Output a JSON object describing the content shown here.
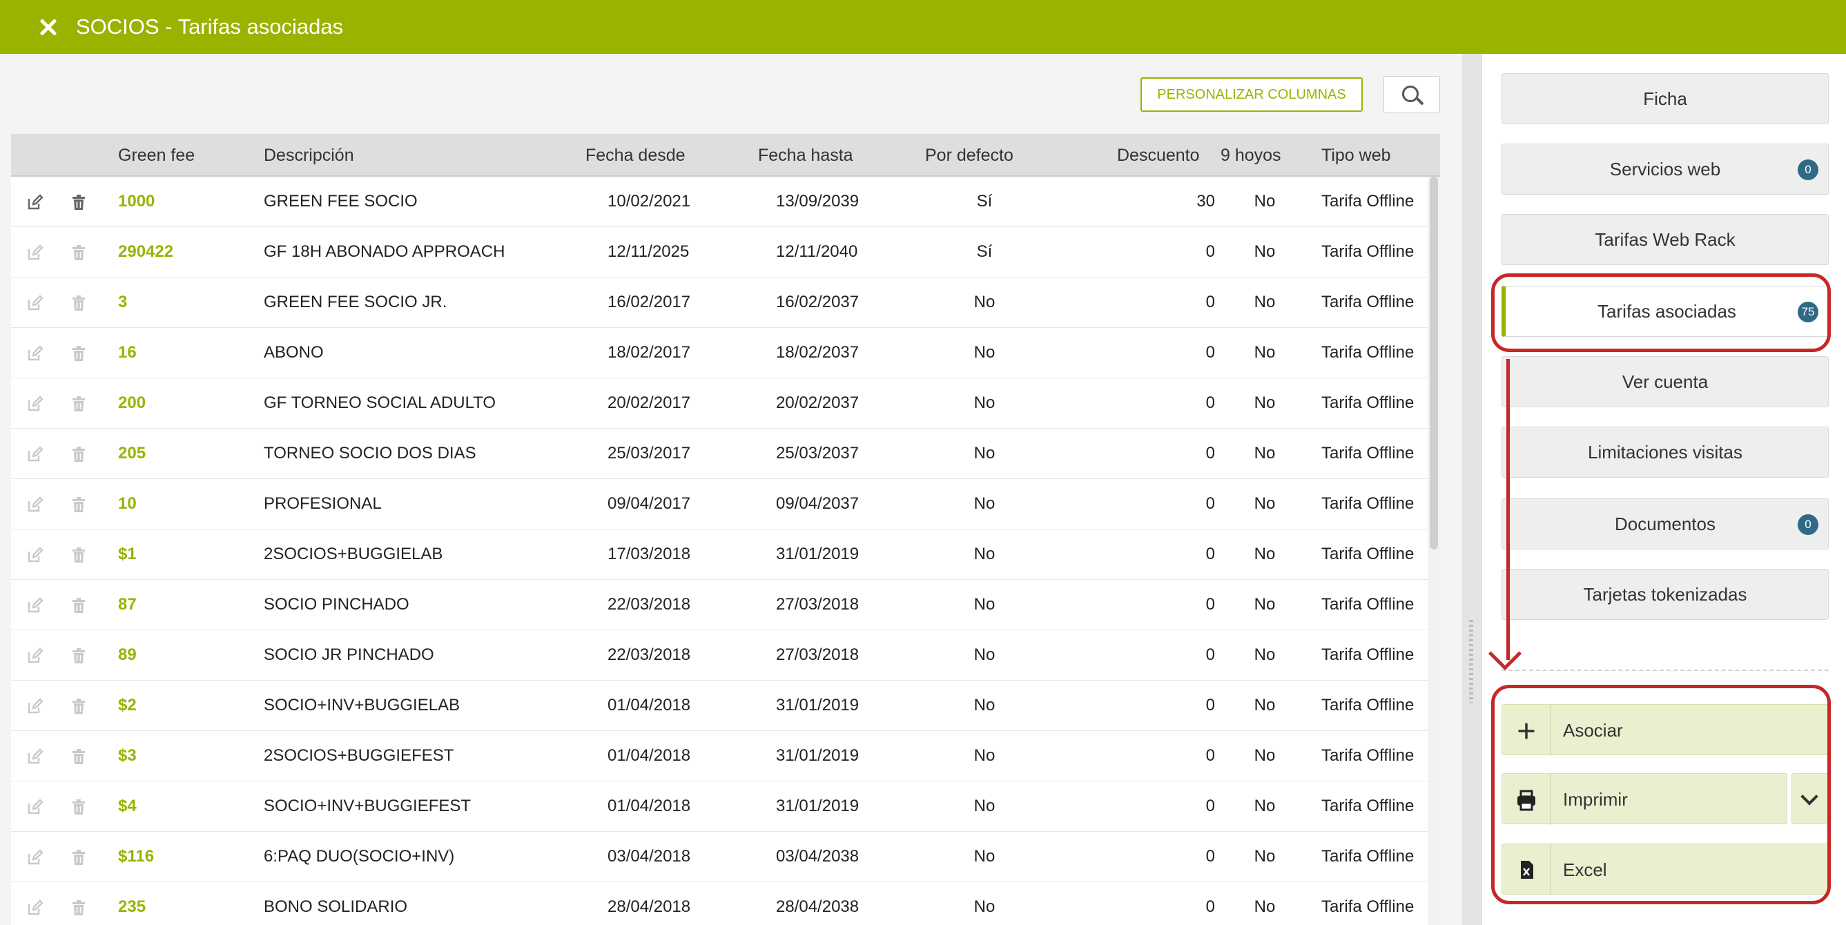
{
  "header": {
    "title": "SOCIOS - Tarifas asociadas"
  },
  "colors": {
    "accent": "#9ab300",
    "badge": "#2e6a86",
    "annotation": "#c62828"
  },
  "toolbar": {
    "customize_label": "PERSONALIZAR COLUMNAS",
    "search_icon": "search-icon"
  },
  "table": {
    "columns": [
      "Green fee",
      "Descripción",
      "Fecha desde",
      "Fecha hasta",
      "Por defecto",
      "Descuento",
      "9 hoyos",
      "Tipo web"
    ],
    "rows": [
      {
        "code": "1000",
        "desc": "GREEN FEE SOCIO",
        "from": "10/02/2021",
        "to": "13/09/2039",
        "default": "Sí",
        "discount": "30",
        "nine": "No",
        "web": "Tarifa Offline"
      },
      {
        "code": "290422",
        "desc": "GF 18H ABONADO APPROACH",
        "from": "12/11/2025",
        "to": "12/11/2040",
        "default": "Sí",
        "discount": "0",
        "nine": "No",
        "web": "Tarifa Offline"
      },
      {
        "code": "3",
        "desc": "GREEN FEE SOCIO JR.",
        "from": "16/02/2017",
        "to": "16/02/2037",
        "default": "No",
        "discount": "0",
        "nine": "No",
        "web": "Tarifa Offline"
      },
      {
        "code": "16",
        "desc": "ABONO",
        "from": "18/02/2017",
        "to": "18/02/2037",
        "default": "No",
        "discount": "0",
        "nine": "No",
        "web": "Tarifa Offline"
      },
      {
        "code": "200",
        "desc": "GF TORNEO SOCIAL ADULTO",
        "from": "20/02/2017",
        "to": "20/02/2037",
        "default": "No",
        "discount": "0",
        "nine": "No",
        "web": "Tarifa Offline"
      },
      {
        "code": "205",
        "desc": "TORNEO SOCIO DOS DIAS",
        "from": "25/03/2017",
        "to": "25/03/2037",
        "default": "No",
        "discount": "0",
        "nine": "No",
        "web": "Tarifa Offline"
      },
      {
        "code": "10",
        "desc": "PROFESIONAL",
        "from": "09/04/2017",
        "to": "09/04/2037",
        "default": "No",
        "discount": "0",
        "nine": "No",
        "web": "Tarifa Offline"
      },
      {
        "code": "$1",
        "desc": "2SOCIOS+BUGGIELAB",
        "from": "17/03/2018",
        "to": "31/01/2019",
        "default": "No",
        "discount": "0",
        "nine": "No",
        "web": "Tarifa Offline"
      },
      {
        "code": "87",
        "desc": "SOCIO PINCHADO",
        "from": "22/03/2018",
        "to": "27/03/2018",
        "default": "No",
        "discount": "0",
        "nine": "No",
        "web": "Tarifa Offline"
      },
      {
        "code": "89",
        "desc": "SOCIO JR PINCHADO",
        "from": "22/03/2018",
        "to": "27/03/2018",
        "default": "No",
        "discount": "0",
        "nine": "No",
        "web": "Tarifa Offline"
      },
      {
        "code": "$2",
        "desc": "SOCIO+INV+BUGGIELAB",
        "from": "01/04/2018",
        "to": "31/01/2019",
        "default": "No",
        "discount": "0",
        "nine": "No",
        "web": "Tarifa Offline"
      },
      {
        "code": "$3",
        "desc": "2SOCIOS+BUGGIEFEST",
        "from": "01/04/2018",
        "to": "31/01/2019",
        "default": "No",
        "discount": "0",
        "nine": "No",
        "web": "Tarifa Offline"
      },
      {
        "code": "$4",
        "desc": "SOCIO+INV+BUGGIEFEST",
        "from": "01/04/2018",
        "to": "31/01/2019",
        "default": "No",
        "discount": "0",
        "nine": "No",
        "web": "Tarifa Offline"
      },
      {
        "code": "$116",
        "desc": "6:PAQ DUO(SOCIO+INV)",
        "from": "03/04/2018",
        "to": "03/04/2038",
        "default": "No",
        "discount": "0",
        "nine": "No",
        "web": "Tarifa Offline"
      },
      {
        "code": "235",
        "desc": "BONO SOLIDARIO",
        "from": "28/04/2018",
        "to": "28/04/2038",
        "default": "No",
        "discount": "0",
        "nine": "No",
        "web": "Tarifa Offline"
      }
    ]
  },
  "side_menu": [
    {
      "label": "Ficha"
    },
    {
      "label": "Servicios web",
      "badge": "0"
    },
    {
      "label": "Tarifas Web Rack"
    },
    {
      "label": "Tarifas asociadas",
      "badge": "75",
      "active": true
    },
    {
      "label": "Ver cuenta"
    },
    {
      "label": "Limitaciones visitas"
    },
    {
      "label": "Documentos",
      "badge": "0"
    },
    {
      "label": "Tarjetas tokenizadas"
    }
  ],
  "actions": {
    "associate_label": "Asociar",
    "print_label": "Imprimir",
    "excel_label": "Excel"
  }
}
